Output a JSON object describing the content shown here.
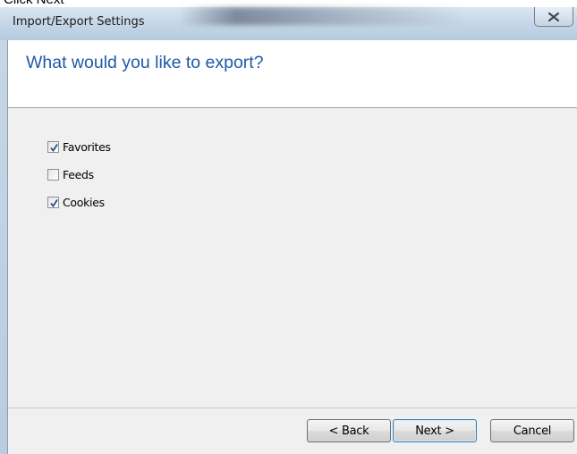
{
  "caption": "Click Next",
  "window": {
    "title": "Import/Export Settings",
    "close_glyph": "close-icon"
  },
  "header": {
    "title": "What would you like to export?"
  },
  "options": [
    {
      "label": "Favorites",
      "checked": true
    },
    {
      "label": "Feeds",
      "checked": false
    },
    {
      "label": "Cookies",
      "checked": true
    }
  ],
  "buttons": {
    "back": "< Back",
    "next": "Next >",
    "cancel": "Cancel"
  },
  "colors": {
    "header_title": "#1e5aa8",
    "client_bg": "#f0f0f0",
    "check_mark": "#2b4f8a"
  }
}
